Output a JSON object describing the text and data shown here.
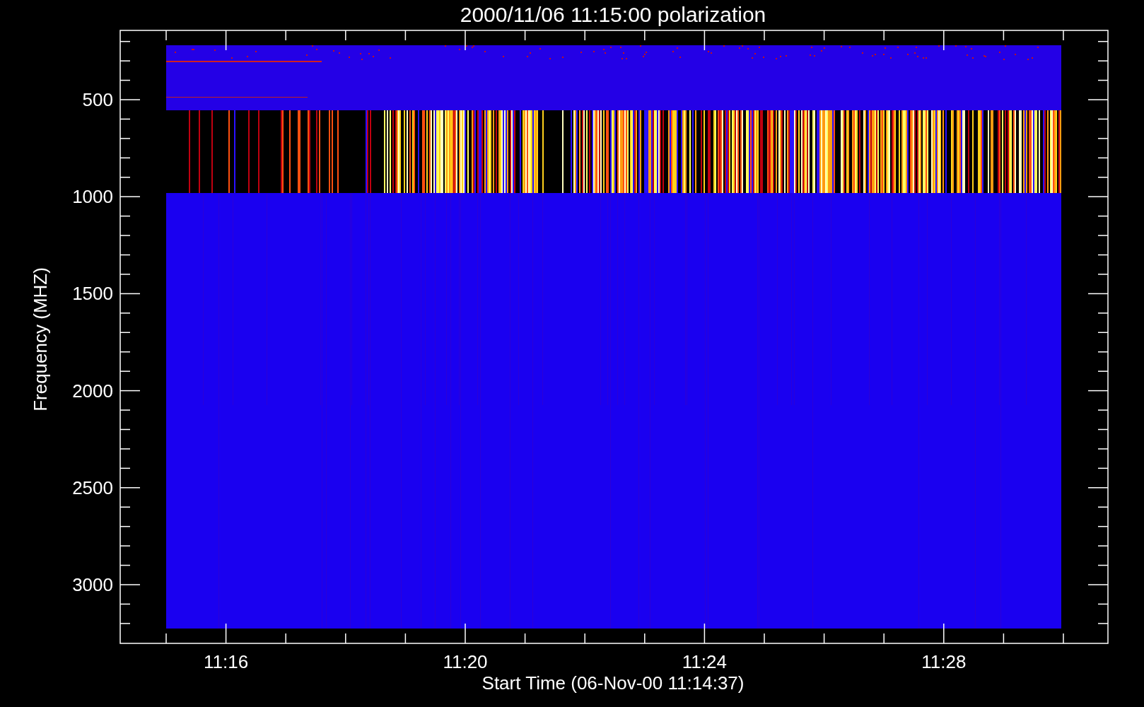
{
  "title": "2000/11/06 11:15:00 polarization",
  "y_axis": {
    "label": "Frequency (MHZ)",
    "ticks": [
      "500",
      "1000",
      "1500",
      "2000",
      "2500",
      "3000"
    ]
  },
  "x_axis": {
    "label": "Start Time (06-Nov-00 11:14:37)",
    "ticks": [
      "11:16",
      "11:20",
      "11:24",
      "11:28"
    ]
  }
}
